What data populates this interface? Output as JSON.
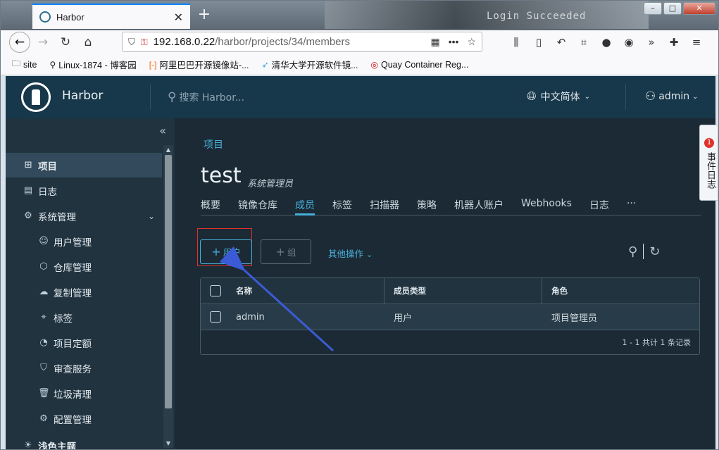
{
  "browser": {
    "tab_title": "Harbor",
    "url_host": "192.168.0.22",
    "url_path": "/harbor/projects/34/members",
    "bg_window_text": "Login Succeeded"
  },
  "bookmarks": [
    {
      "label": "site"
    },
    {
      "label": "Linux-1874 - 博客园"
    },
    {
      "label": "阿里巴巴开源镜像站-..."
    },
    {
      "label": "清华大学开源软件镜..."
    },
    {
      "label": "Quay Container Reg..."
    }
  ],
  "header": {
    "brand": "Harbor",
    "search_placeholder": "搜索 Harbor...",
    "language": "中文简体",
    "user": "admin"
  },
  "sidebar": {
    "items": [
      {
        "label": "项目"
      },
      {
        "label": "日志"
      },
      {
        "label": "系统管理"
      },
      {
        "label": "用户管理"
      },
      {
        "label": "仓库管理"
      },
      {
        "label": "复制管理"
      },
      {
        "label": "标签"
      },
      {
        "label": "项目定额"
      },
      {
        "label": "审查服务"
      },
      {
        "label": "垃圾清理"
      },
      {
        "label": "配置管理"
      },
      {
        "label": "浅色主题"
      }
    ]
  },
  "page": {
    "breadcrumb": "项目",
    "title": "test",
    "role": "系统管理员",
    "tabs": [
      "概要",
      "镜像仓库",
      "成员",
      "标签",
      "扫描器",
      "策略",
      "机器人账户",
      "Webhooks",
      "日志",
      "···"
    ],
    "active_tab": "成员",
    "buttons": {
      "add_user": "用户",
      "add_group": "组",
      "more_ops": "其他操作"
    },
    "table": {
      "columns": [
        "名称",
        "成员类型",
        "角色"
      ],
      "rows": [
        {
          "name": "admin",
          "type": "用户",
          "role": "项目管理员"
        }
      ],
      "footer": "1 - 1 共计 1 条记录"
    }
  },
  "event_log": {
    "label": "事件日志",
    "badge": "1"
  },
  "colors": {
    "accent": "#49afd9",
    "header_bg": "#17374a",
    "sidebar_bg": "#21333f",
    "content_bg": "#1b2a35",
    "highlight_box": "#e0312b",
    "annotation_arrow": "#3b5bd6"
  }
}
